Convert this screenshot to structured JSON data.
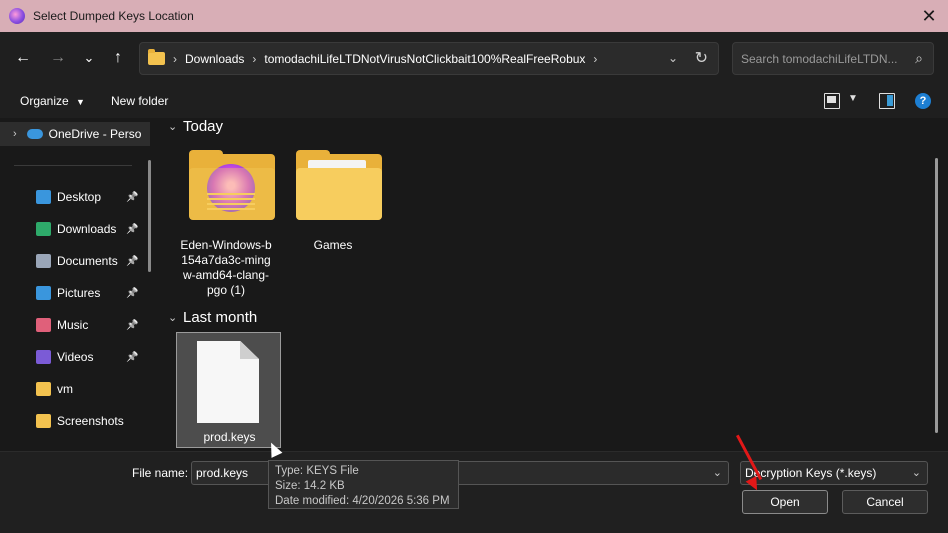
{
  "window": {
    "title": "Select Dumped Keys Location",
    "close_glyph": "✕",
    "app_icon": "eden-app-icon"
  },
  "navigation": {
    "back_glyph": "←",
    "forward_glyph": "→",
    "recent_glyph": "⌄",
    "up_glyph": "↑",
    "breadcrumbs": [
      "Downloads",
      "tomodachiLifeLTDNotVirusNotClickbait100%RealFreeRobux"
    ],
    "refresh_glyph": "↻",
    "search_placeholder": "Search tomodachiLifeLTDN..."
  },
  "toolbar": {
    "organize_label": "Organize",
    "new_folder_label": "New folder",
    "help_glyph": "?"
  },
  "sidebar": {
    "onedrive_label": "OneDrive - Perso",
    "items": [
      {
        "label": "Desktop",
        "icon": "desktop-icon",
        "color": "#3a96dd"
      },
      {
        "label": "Downloads",
        "icon": "download-icon",
        "color": "#2eaa6a"
      },
      {
        "label": "Documents",
        "icon": "document-icon",
        "color": "#9aa6b8"
      },
      {
        "label": "Pictures",
        "icon": "pictures-icon",
        "color": "#3a96dd"
      },
      {
        "label": "Music",
        "icon": "music-icon",
        "color": "#e0607a"
      },
      {
        "label": "Videos",
        "icon": "videos-icon",
        "color": "#7b5bd6"
      },
      {
        "label": "vm",
        "icon": "folder-icon",
        "color": "#f3c24f"
      },
      {
        "label": "Screenshots",
        "icon": "folder-icon",
        "color": "#f3c24f"
      }
    ]
  },
  "content": {
    "groups": [
      {
        "title": "Today",
        "items": [
          {
            "label": "Eden-Windows-b154a7da3c-mingw-amd64-clang-pgo (1)",
            "lines": [
              "Eden-Windows-b",
              "154a7da3c-ming",
              "w-amd64-clang-",
              "pgo (1)"
            ],
            "type": "folder"
          },
          {
            "label": "Games",
            "lines": [
              "Games"
            ],
            "type": "folder"
          }
        ]
      },
      {
        "title": "Last month",
        "items": [
          {
            "label": "prod.keys",
            "type": "file",
            "selected": true
          }
        ]
      }
    ]
  },
  "tooltip": {
    "type_line": "Type: KEYS File",
    "size_line": "Size: 14.2 KB",
    "date_line": "Date modified: 4/20/2026 5:36 PM"
  },
  "footer": {
    "file_name_label": "File name:",
    "file_name_value": "prod.keys",
    "file_type_value": "Decryption Keys (*.keys)",
    "open_label": "Open",
    "cancel_label": "Cancel"
  }
}
